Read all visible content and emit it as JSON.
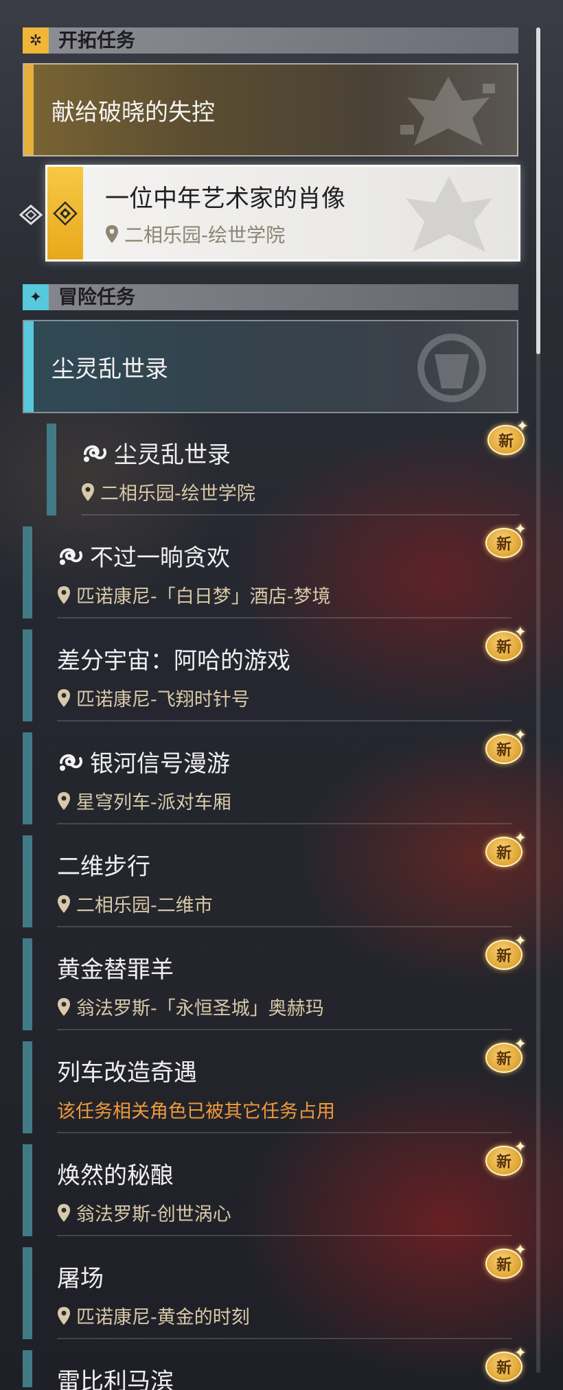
{
  "trailblaze": {
    "header": "开拓任务",
    "header_icon": "trailblaze-icon",
    "accent": "#f0b63a",
    "banner_title": "献给破晓的失控",
    "selected": {
      "title": "一位中年艺术家的肖像",
      "location": "二相乐园-绘世学院"
    }
  },
  "adventure": {
    "header": "冒险任务",
    "header_icon": "adventure-icon",
    "accent": "#58c8dc",
    "banner_title": "尘灵乱世录",
    "sub_item": {
      "title": "尘灵乱世录",
      "location": "二相乐园-绘世学院",
      "badge": "新"
    },
    "items": [
      {
        "title": "不过一晌贪欢",
        "subtitle": "匹诺康尼-「白日梦」酒店-梦境",
        "badge": "新"
      },
      {
        "title": "差分宇宙：阿哈的游戏",
        "subtitle": "匹诺康尼-飞翔时针号",
        "badge": "新"
      },
      {
        "title": "银河信号漫游",
        "subtitle": "星穹列车-派对车厢",
        "badge": "新"
      },
      {
        "title": "二维步行",
        "subtitle": "二相乐园-二维市",
        "badge": "新"
      },
      {
        "title": "黄金替罪羊",
        "subtitle": "翁法罗斯-「永恒圣城」奥赫玛",
        "badge": "新"
      },
      {
        "title": "列车改造奇遇",
        "subtitle": "该任务相关角色已被其它任务占用",
        "badge": "新"
      },
      {
        "title": "焕然的秘酿",
        "subtitle": "翁法罗斯-创世涡心",
        "badge": "新"
      },
      {
        "title": "屠场",
        "subtitle": "匹诺康尼-黄金的时刻",
        "badge": "新"
      },
      {
        "title": "雷比利马滨",
        "badge": "新"
      }
    ]
  },
  "colors": {
    "quest_bar": "#417a85",
    "warning_text": "#f09a3a",
    "location_text": "#d8c9a8"
  }
}
